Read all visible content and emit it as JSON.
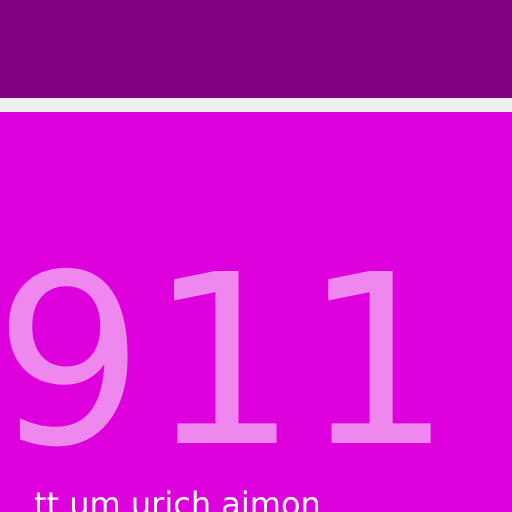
{
  "tile": {
    "number": "911",
    "caption": "tt um urich aimon"
  },
  "colors": {
    "top_bar": "#800080",
    "divider": "#eeeeee",
    "tile_background": "#dd00dd",
    "number_text": "#ee88ee",
    "caption_text": "#ffffff"
  }
}
